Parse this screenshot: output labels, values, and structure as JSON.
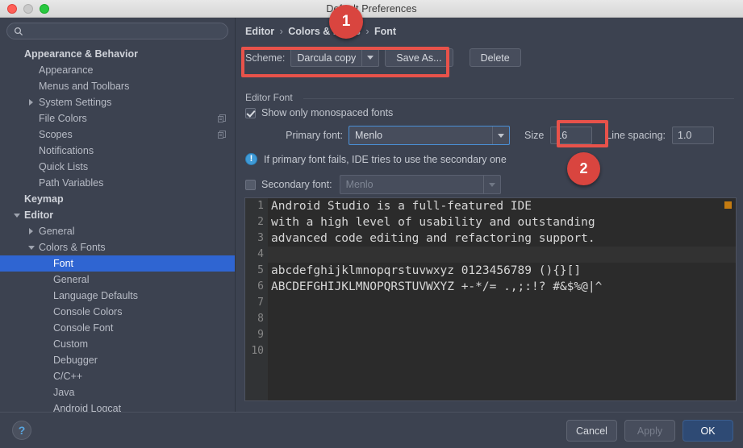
{
  "window": {
    "title": "Default Preferences",
    "traffic": [
      "close-button",
      "minimize-button",
      "maximize-button"
    ]
  },
  "sidebar": {
    "search": {
      "value": "",
      "placeholder": "",
      "icon": "search-icon"
    },
    "items": [
      {
        "label": "Appearance & Behavior",
        "indent": 1,
        "bold": true,
        "twisty": "none"
      },
      {
        "label": "Appearance",
        "indent": 2,
        "bold": false,
        "twisty": "none"
      },
      {
        "label": "Menus and Toolbars",
        "indent": 2,
        "bold": false,
        "twisty": "none"
      },
      {
        "label": "System Settings",
        "indent": 2,
        "bold": false,
        "twisty": "right"
      },
      {
        "label": "File Colors",
        "indent": 2,
        "bold": false,
        "twisty": "none",
        "trailing_icon": "copy-icon"
      },
      {
        "label": "Scopes",
        "indent": 2,
        "bold": false,
        "twisty": "none",
        "trailing_icon": "copy-icon"
      },
      {
        "label": "Notifications",
        "indent": 2,
        "bold": false,
        "twisty": "none"
      },
      {
        "label": "Quick Lists",
        "indent": 2,
        "bold": false,
        "twisty": "none"
      },
      {
        "label": "Path Variables",
        "indent": 2,
        "bold": false,
        "twisty": "none"
      },
      {
        "label": "Keymap",
        "indent": 1,
        "bold": true,
        "twisty": "none"
      },
      {
        "label": "Editor",
        "indent": 1,
        "bold": true,
        "twisty": "down"
      },
      {
        "label": "General",
        "indent": 2,
        "bold": false,
        "twisty": "right"
      },
      {
        "label": "Colors & Fonts",
        "indent": 2,
        "bold": false,
        "twisty": "down"
      },
      {
        "label": "Font",
        "indent": 3,
        "bold": false,
        "twisty": "none",
        "selected": true
      },
      {
        "label": "General",
        "indent": 3,
        "bold": false,
        "twisty": "none"
      },
      {
        "label": "Language Defaults",
        "indent": 3,
        "bold": false,
        "twisty": "none"
      },
      {
        "label": "Console Colors",
        "indent": 3,
        "bold": false,
        "twisty": "none"
      },
      {
        "label": "Console Font",
        "indent": 3,
        "bold": false,
        "twisty": "none"
      },
      {
        "label": "Custom",
        "indent": 3,
        "bold": false,
        "twisty": "none"
      },
      {
        "label": "Debugger",
        "indent": 3,
        "bold": false,
        "twisty": "none"
      },
      {
        "label": "C/C++",
        "indent": 3,
        "bold": false,
        "twisty": "none"
      },
      {
        "label": "Java",
        "indent": 3,
        "bold": false,
        "twisty": "none"
      },
      {
        "label": "Android Logcat",
        "indent": 3,
        "bold": false,
        "twisty": "none"
      }
    ]
  },
  "breadcrumb": {
    "part1": "Editor",
    "sep1": "›",
    "part2": "Colors & Fonts",
    "sep2": "›",
    "part3": "Font"
  },
  "scheme": {
    "label": "Scheme:",
    "value": "Darcula copy",
    "save_as_label": "Save As...",
    "delete_label": "Delete"
  },
  "editor_font": {
    "group_title": "Editor Font",
    "monospaced_checkbox_label": "Show only monospaced fonts",
    "monospaced_checked": true,
    "primary_font_label": "Primary font:",
    "primary_font_value": "Menlo",
    "size_label": "Size",
    "size_value": "16",
    "line_spacing_label": "Line spacing:",
    "line_spacing_value": "1.0",
    "info_text": "If primary font fails, IDE tries to use the secondary one",
    "info_icon_glyph": "!",
    "secondary_font_label": "Secondary font:",
    "secondary_font_value": "Menlo",
    "secondary_enabled": false
  },
  "preview": {
    "line_numbers": [
      "1",
      "2",
      "3",
      "4",
      "5",
      "6",
      "7",
      "8",
      "9",
      "10"
    ],
    "caret_line_index": 3,
    "lines": [
      "Android Studio is a full-featured IDE",
      "with a high level of usability and outstanding",
      "advanced code editing and refactoring support.",
      "",
      "abcdefghijklmnopqrstuvwxyz 0123456789 (){}[]",
      "ABCDEFGHIJKLMNOPQRSTUVWXYZ +-*/= .,;:!? #&$%@|^",
      "",
      "",
      "",
      ""
    ],
    "marker_color": "#c47b11"
  },
  "footer": {
    "help_label": "?",
    "cancel_label": "Cancel",
    "apply_label": "Apply",
    "apply_enabled": false,
    "ok_label": "OK"
  },
  "annotations": {
    "highlight_color": "#e8524a",
    "badges": [
      {
        "number": "1"
      },
      {
        "number": "2"
      }
    ]
  }
}
